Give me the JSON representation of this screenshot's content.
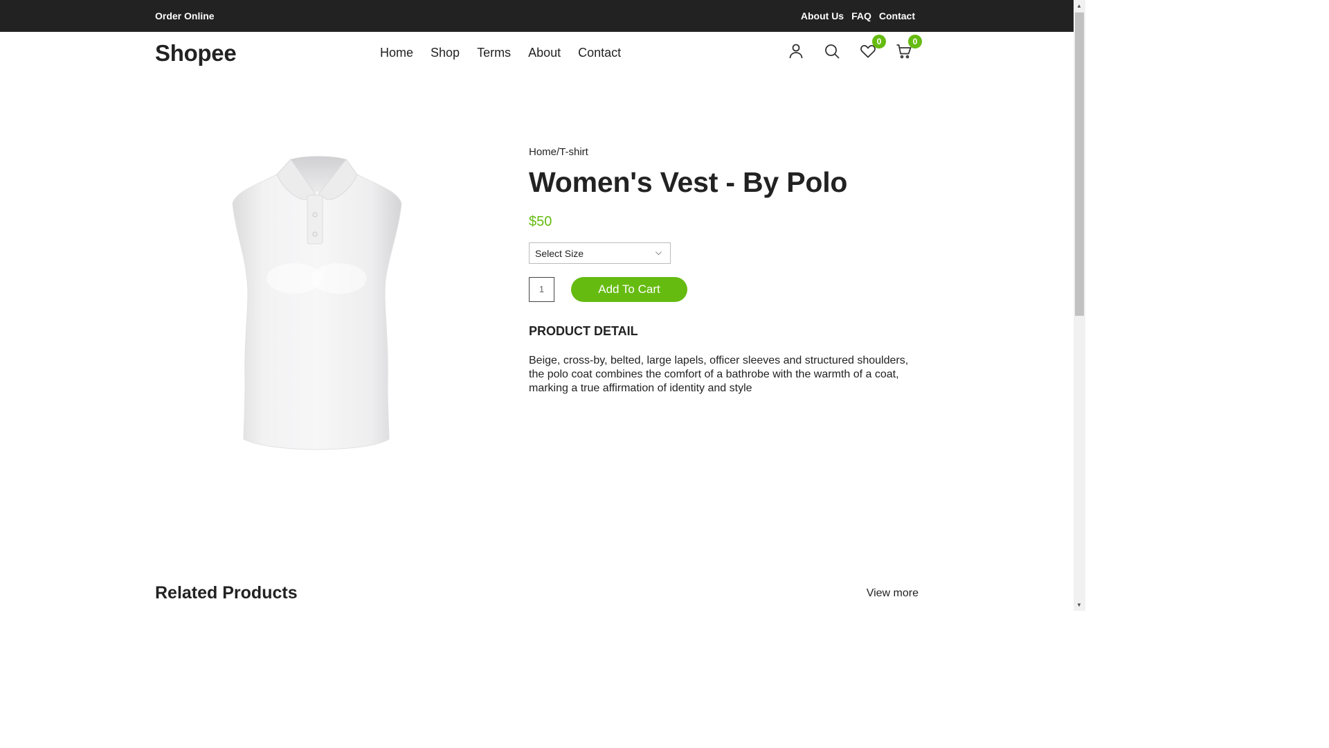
{
  "topbar": {
    "left": "Order Online",
    "links": [
      "About Us",
      "FAQ",
      "Contact"
    ]
  },
  "header": {
    "logo": "Shopee",
    "nav": [
      "Home",
      "Shop",
      "Terms",
      "About",
      "Contact"
    ],
    "icons": [
      "user-icon",
      "search-icon",
      "heart-icon",
      "cart-icon"
    ],
    "wishlist_count": "0",
    "cart_count": "0"
  },
  "product": {
    "breadcrumb": "Home/T-shirt",
    "title": "Women's Vest - By Polo",
    "price": "$50",
    "size_select": "Select Size",
    "quantity": "1",
    "add_to_cart": "Add To Cart",
    "detail_heading": "PRODUCT DETAIL",
    "detail_text": "Beige, cross-by, belted, large lapels, officer sleeves and structured shoulders, the polo coat combines the comfort of a bathrobe with the warmth of a coat, marking a true affirmation of identity and style"
  },
  "related": {
    "heading": "Related Products",
    "view_more": "View more"
  },
  "colors": {
    "accent": "#66bb11",
    "topbar": "#222222"
  }
}
